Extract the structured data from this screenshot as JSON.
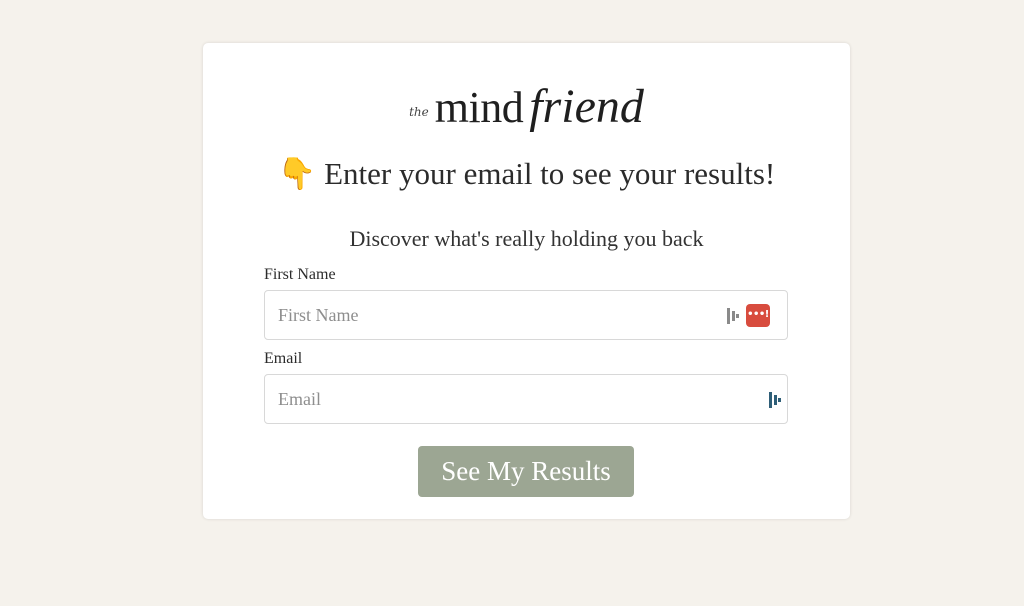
{
  "logo": {
    "the": "the",
    "mind": "mind",
    "friend": "friend"
  },
  "headline": {
    "emoji": "👇",
    "text": "Enter your email to see your results!"
  },
  "subhead": "Discover what's really holding you back",
  "form": {
    "first_name": {
      "label": "First Name",
      "placeholder": "First Name",
      "value": ""
    },
    "email": {
      "label": "Email",
      "placeholder": "Email",
      "value": ""
    },
    "submit_label": "See My Results"
  },
  "icons": {
    "autofill_extension_icon": "autofill-extension-icon",
    "password_manager_icon": "password-manager-icon",
    "password_manager_glyph": "•••!"
  },
  "colors": {
    "page_background": "#f5f2ec",
    "card_background": "#ffffff",
    "button_background": "#9ca693",
    "password_manager_red": "#d84c3e",
    "extension_icon_gray": "#8a8a8a",
    "extension_icon_teal": "#2f5f78"
  }
}
